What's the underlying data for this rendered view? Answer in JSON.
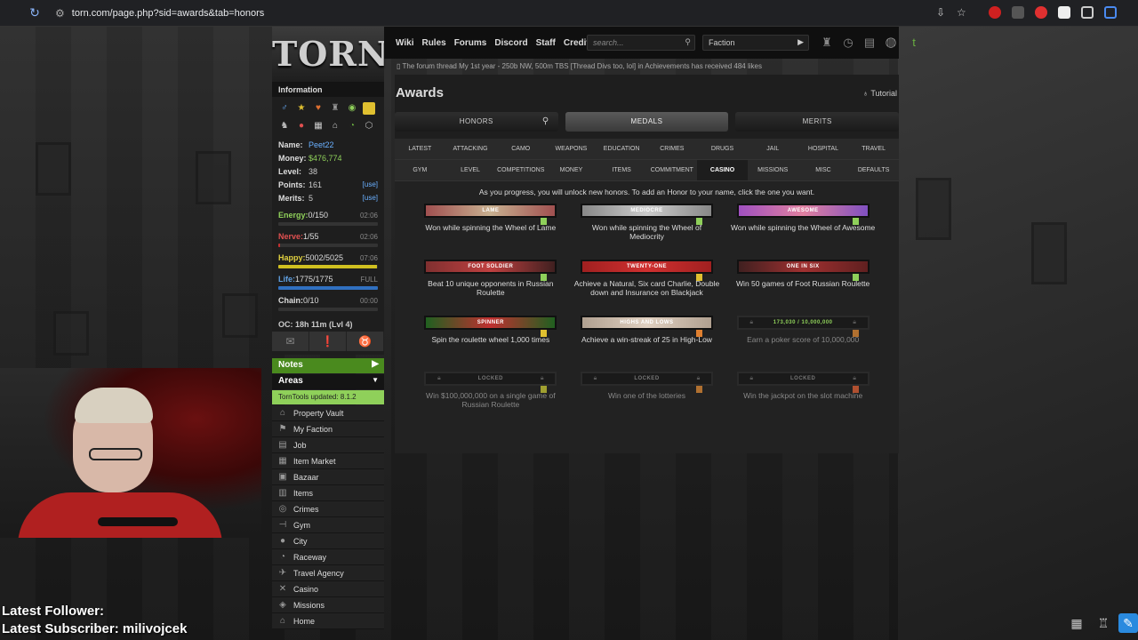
{
  "browser": {
    "url": "torn.com/page.php?sid=awards&tab=honors"
  },
  "logo": "TORN",
  "topnav": {
    "links": [
      "Wiki",
      "Rules",
      "Forums",
      "Discord",
      "Staff",
      "Credits"
    ],
    "search_placeholder": "search...",
    "faction_select": "Faction"
  },
  "ticker": "The forum thread My 1st year - 250b NW, 500m TBS [Thread Divs too, lol] in Achievements has received 484 likes",
  "sidebar": {
    "info_title": "Information",
    "name_label": "Name:",
    "name": "Peet22",
    "money_label": "Money:",
    "money": "$476,774",
    "level_label": "Level:",
    "level": "38",
    "points_label": "Points:",
    "points": "161",
    "merits_label": "Merits:",
    "merits": "5",
    "use_label": "[use]",
    "bars": [
      {
        "label": "Energy:",
        "value": "0/150",
        "time": "02:06",
        "fill": 0.0,
        "color": "#5fa82a",
        "label_color": "#8fd05a"
      },
      {
        "label": "Nerve:",
        "value": "1/55",
        "time": "02:06",
        "fill": 0.02,
        "color": "#c03030",
        "label_color": "#e05050"
      },
      {
        "label": "Happy:",
        "value": "5002/5025",
        "time": "07:06",
        "fill": 0.995,
        "color": "#d0c020",
        "label_color": "#e0d040"
      },
      {
        "label": "Life:",
        "value": "1775/1775",
        "time": "FULL",
        "fill": 1.0,
        "color": "#3070c0",
        "label_color": "#60a0e0"
      },
      {
        "label": "Chain:",
        "value": "0/10",
        "time": "00:00",
        "fill": 0.0,
        "color": "#888888",
        "label_color": "#dddddd"
      }
    ],
    "oc": "OC: 18h 11m (Lvl 4)",
    "notes": "Notes",
    "areas": "Areas",
    "torntools": "TornTools updated: 8.1.2",
    "area_items": [
      {
        "icon": "vault-icon",
        "glyph": "⌂",
        "label": "Property Vault"
      },
      {
        "icon": "faction-icon",
        "glyph": "⚑",
        "label": "My Faction"
      },
      {
        "icon": "job-icon",
        "glyph": "▤",
        "label": "Job"
      },
      {
        "icon": "market-icon",
        "glyph": "▦",
        "label": "Item Market"
      },
      {
        "icon": "bazaar-icon",
        "glyph": "▣",
        "label": "Bazaar"
      },
      {
        "icon": "items-icon",
        "glyph": "▥",
        "label": "Items"
      },
      {
        "icon": "crimes-icon",
        "glyph": "◎",
        "label": "Crimes"
      },
      {
        "icon": "gym-icon",
        "glyph": "⊣",
        "label": "Gym"
      },
      {
        "icon": "city-icon",
        "glyph": "●",
        "label": "City"
      },
      {
        "icon": "raceway-icon",
        "glyph": "◔",
        "label": "Raceway"
      },
      {
        "icon": "travel-icon",
        "glyph": "✈",
        "label": "Travel Agency"
      },
      {
        "icon": "casino-icon",
        "glyph": "✕",
        "label": "Casino"
      },
      {
        "icon": "missions-icon",
        "glyph": "◈",
        "label": "Missions"
      },
      {
        "icon": "home-icon",
        "glyph": "⌂",
        "label": "Home"
      }
    ]
  },
  "awards": {
    "title": "Awards",
    "tutorial": "Tutorial",
    "tabs": [
      "HONORS",
      "MEDALS",
      "MERITS"
    ],
    "categories": [
      "LATEST",
      "ATTACKING",
      "CAMO",
      "WEAPONS",
      "EDUCATION",
      "CRIMES",
      "DRUGS",
      "JAIL",
      "HOSPITAL",
      "TRAVEL",
      "GYM",
      "LEVEL",
      "COMPETITIONS",
      "MONEY",
      "ITEMS",
      "COMMITMENT",
      "CASINO",
      "MISSIONS",
      "MISC",
      "DEFAULTS"
    ],
    "active_category": "CASINO",
    "hint": "As you progress, you will unlock new honors. To add an Honor to your name, click the one you want.",
    "medals": [
      {
        "banner": "LAME",
        "desc": "Won while spinning the Wheel of Lame",
        "bg": "linear-gradient(90deg,#a05050,#c8b090,#a05050)",
        "flag": "#8fd05a",
        "locked": false
      },
      {
        "banner": "MEDIOCRE",
        "desc": "Won while spinning the Wheel of Mediocrity",
        "bg": "linear-gradient(90deg,#888,#ccc,#888)",
        "flag": "#8fd05a",
        "locked": false
      },
      {
        "banner": "AWESOME",
        "desc": "Won while spinning the Wheel of Awesome",
        "bg": "linear-gradient(90deg,#a050c0,#e080a0,#8050c0)",
        "flag": "#8fd05a",
        "locked": false
      },
      {
        "banner": "FOOT SOLDIER",
        "desc": "Beat 10 unique opponents in Russian Roulette",
        "bg": "linear-gradient(90deg,#803030,#c04040,#402020)",
        "flag": "#8fd05a",
        "locked": false
      },
      {
        "banner": "TWENTY-ONE",
        "desc": "Achieve a Natural, Six card Charlie, Double down and Insurance on Blackjack",
        "bg": "linear-gradient(90deg,#a02020,#d03030,#a02020)",
        "flag": "#e0c030",
        "locked": false
      },
      {
        "banner": "ONE IN SIX",
        "desc": "Win 50 games of Foot Russian Roulette",
        "bg": "linear-gradient(90deg,#402020,#a03030,#602020)",
        "flag": "#8fd05a",
        "locked": false
      },
      {
        "banner": "SPINNER",
        "desc": "Spin the roulette wheel 1,000 times",
        "bg": "linear-gradient(90deg,#206020,#c03030,#206020)",
        "flag": "#e0c030",
        "locked": false
      },
      {
        "banner": "HIGHS AND LOWS",
        "desc": "Achieve a win-streak of 25 in High-Low",
        "bg": "linear-gradient(90deg,#b0a090,#e0d0c0,#b0a090)",
        "flag": "#e08030",
        "locked": false
      },
      {
        "banner": "173,030 / 10,000,000",
        "desc": "Earn a poker score of 10,000,000",
        "bg": "#1a1a1a",
        "flag": "#b07030",
        "locked": true,
        "progress": true
      },
      {
        "banner": "Locked",
        "desc": "Win $100,000,000 on a single game of Russian Roulette",
        "bg": "#1a1a1a",
        "flag": "#a0a030",
        "locked": true
      },
      {
        "banner": "Locked",
        "desc": "Win one of the lotteries",
        "bg": "#1a1a1a",
        "flag": "#b07030",
        "locked": true
      },
      {
        "banner": "Locked",
        "desc": "Win the jackpot on the slot machine",
        "bg": "#1a1a1a",
        "flag": "#b05030",
        "locked": true
      }
    ]
  },
  "stream_overlay": {
    "follower": "Latest Follower:",
    "subscriber": "Latest Subscriber: milivojcek"
  }
}
